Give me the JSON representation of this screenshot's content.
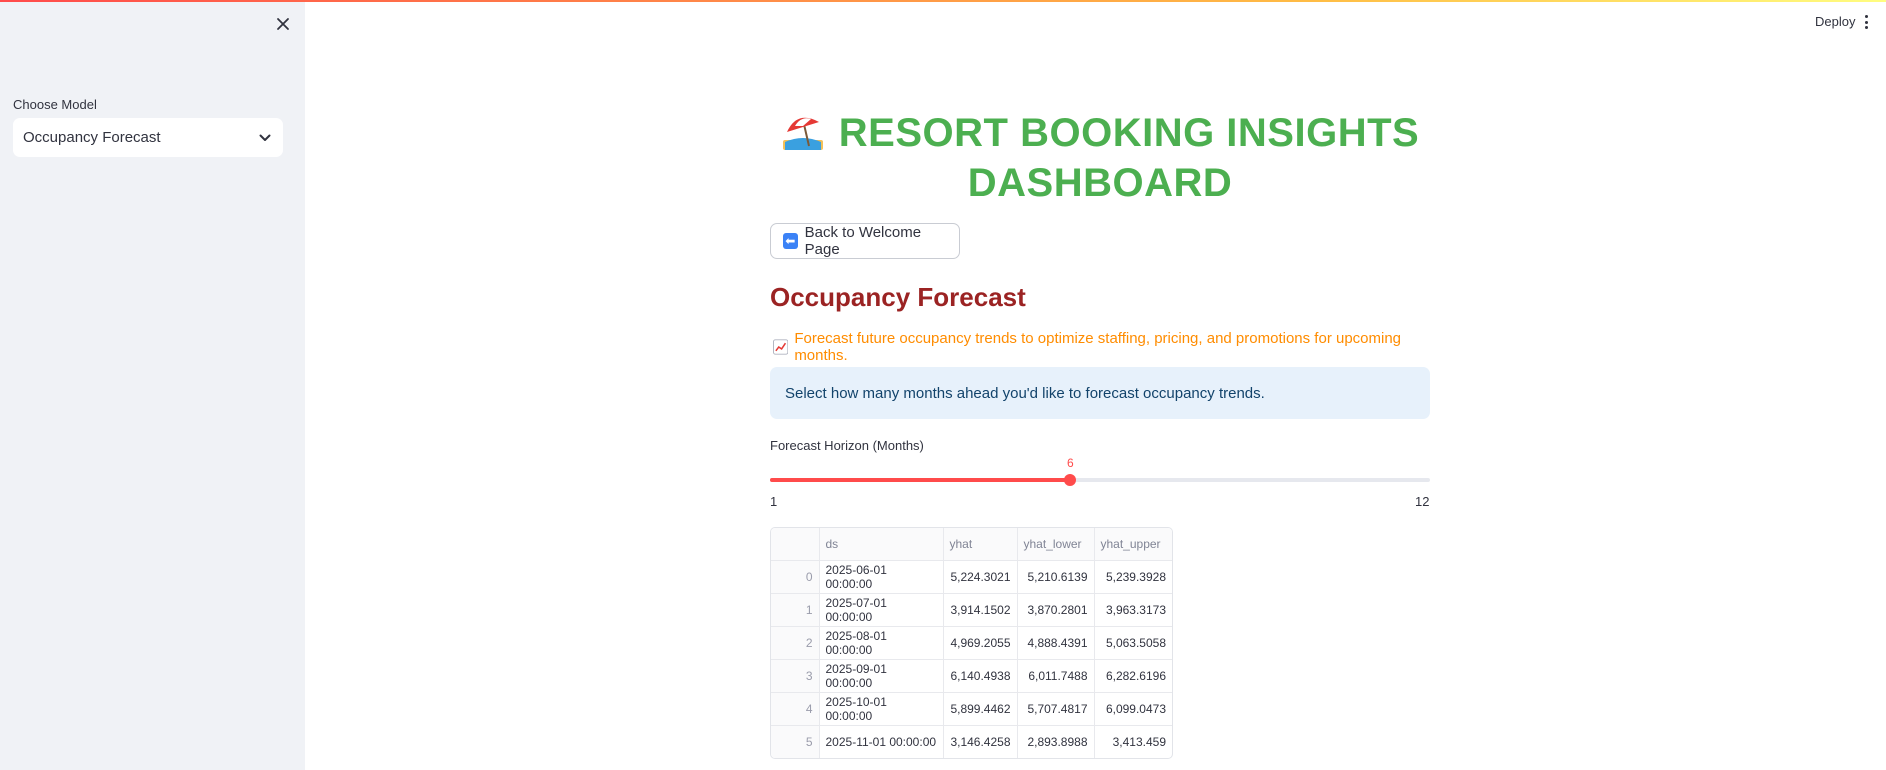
{
  "app": {
    "deploy_label": "Deploy"
  },
  "sidebar": {
    "model_label": "Choose Model",
    "model_selected": "Occupancy Forecast"
  },
  "header": {
    "title_line1": "RESORT BOOKING INSIGHTS",
    "title_line2": "DASHBOARD",
    "title_icon": "beach-umbrella-icon"
  },
  "back_button": {
    "icon": "left-arrow-icon",
    "label": "Back to Welcome Page"
  },
  "section": {
    "title": "Occupancy Forecast",
    "description_icon": "chart-increasing-icon",
    "description": "Forecast future occupancy trends to optimize staffing, pricing, and promotions for upcoming months.",
    "info": "Select how many months ahead you'd like to forecast occupancy trends."
  },
  "slider": {
    "label": "Forecast Horizon (Months)",
    "value": "6",
    "min": "1",
    "max": "12",
    "fraction": 0.4545
  },
  "table": {
    "columns": [
      "",
      "ds",
      "yhat",
      "yhat_lower",
      "yhat_upper"
    ],
    "rows": [
      [
        "0",
        "2025-06-01 00:00:00",
        "5,224.3021",
        "5,210.6139",
        "5,239.3928"
      ],
      [
        "1",
        "2025-07-01 00:00:00",
        "3,914.1502",
        "3,870.2801",
        "3,963.3173"
      ],
      [
        "2",
        "2025-08-01 00:00:00",
        "4,969.2055",
        "4,888.4391",
        "5,063.5058"
      ],
      [
        "3",
        "2025-09-01 00:00:00",
        "6,140.4938",
        "6,011.7488",
        "6,282.6196"
      ],
      [
        "4",
        "2025-10-01 00:00:00",
        "5,899.4462",
        "5,707.4817",
        "6,099.0473"
      ],
      [
        "5",
        "2025-11-01 00:00:00",
        "3,146.4258",
        "2,893.8988",
        "3,413.459"
      ]
    ]
  },
  "colors": {
    "title": "#4caf50",
    "section_title": "#9b2323",
    "description": "#ff8c00",
    "accent": "#ff4b4b",
    "info_bg": "#e7f1fb"
  }
}
